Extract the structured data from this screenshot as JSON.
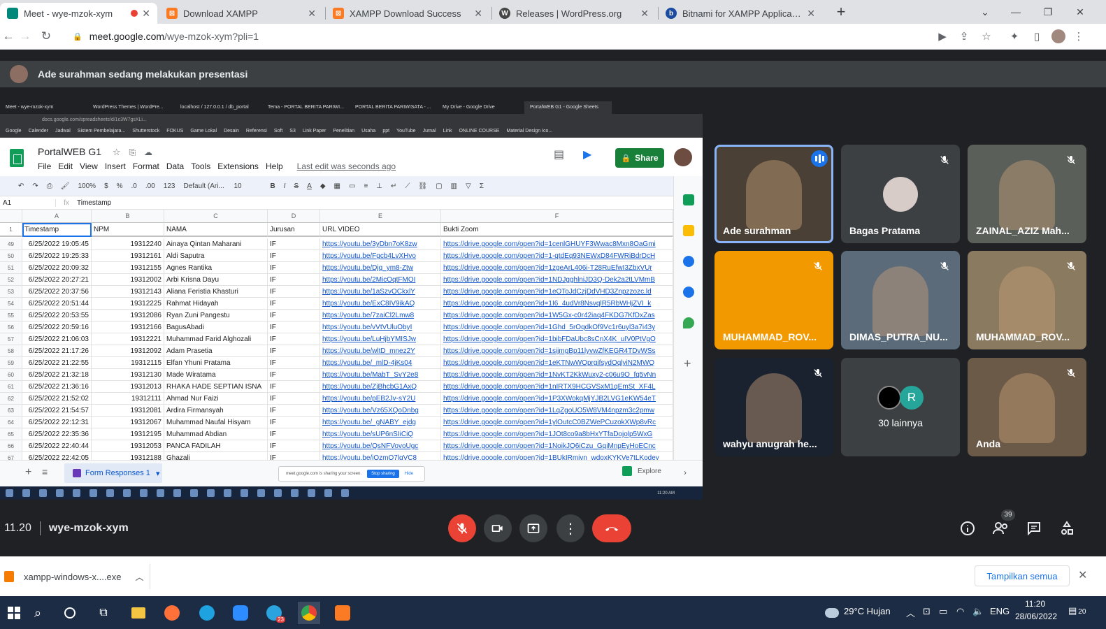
{
  "browser": {
    "tabs": [
      {
        "title": "Meet - wye-mzok-xym",
        "icon": "meet-icon",
        "color": "#00897b"
      },
      {
        "title": "Download XAMPP",
        "icon": "xampp-icon",
        "color": "#fb7a24"
      },
      {
        "title": "XAMPP Download Success",
        "icon": "xampp-icon",
        "color": "#fb7a24"
      },
      {
        "title": "Releases | WordPress.org",
        "icon": "wordpress-icon",
        "color": "#464646"
      },
      {
        "title": "Bitnami for XAMPP Application M",
        "icon": "bitnami-icon",
        "color": "#1c4ba0"
      }
    ],
    "url_host": "meet.google.com",
    "url_path": "/wye-mzok-xym?pli=1"
  },
  "presentation": {
    "banner": "Ade surahman sedang melakukan presentasi"
  },
  "shared_screen": {
    "inner_tabs": [
      "Meet - wye-mzok-xym",
      "WordPress Themes | WordPre...",
      "localhost / 127.0.0.1 / db_portal",
      "Tema - PORTAL BERITA PARIWI...",
      "PORTAL BERITA PARIWISATA - ...",
      "My Drive - Google Drive",
      "PortalWEB G1 - Google Sheets"
    ],
    "inner_url": "docs.google.com/spreadsheets/d/1c3W7gsXLi...",
    "bookmarks": [
      "Google",
      "Calender",
      "Jadwal",
      "Sistem Pembelajara...",
      "Shutterstock",
      "FOKUS",
      "Game Lokal",
      "Desain",
      "Referensi",
      "Soft",
      "S3",
      "Link Paper",
      "Penelitian",
      "Usaha",
      "ppt",
      "YouTube",
      "Jurnal",
      "Link",
      "ONLINE COURSE",
      "Material Design Ico..."
    ],
    "doc_title": "PortalWEB G1",
    "menu": [
      "File",
      "Edit",
      "View",
      "Insert",
      "Format",
      "Data",
      "Tools",
      "Extensions",
      "Help"
    ],
    "last_edit": "Last edit was seconds ago",
    "share_label": "Share",
    "toolbar": {
      "zoom": "100%",
      "currency": "$",
      "percent": "%",
      "dec_less": ".0",
      "dec_more": ".00",
      "num_format": "123",
      "font": "Default (Ari...",
      "font_size": "10"
    },
    "cell_ref": "A1",
    "formula": "Timestamp",
    "columns": [
      "A",
      "B",
      "C",
      "D",
      "E",
      "F"
    ],
    "headers": [
      "Timestamp",
      "NPM",
      "NAMA",
      "Jurusan",
      "URL VIDEO",
      "Bukti Zoom"
    ],
    "rows": [
      {
        "n": "49",
        "ts": "6/25/2022 19:05:45",
        "npm": "19312240",
        "nama": "Ainaya Qintan Maharani",
        "jur": "IF",
        "url": "https://youtu.be/3yDbn7oK8zw",
        "zoom": "https://drive.google.com/open?id=1cenlGHUYF3Wwac8Mxn8OaGmi"
      },
      {
        "n": "50",
        "ts": "6/25/2022 19:25:33",
        "npm": "19312161",
        "nama": "Aldi Saputra",
        "jur": "IF",
        "url": "https://youtu.be/Fgcb4LvXHvo",
        "zoom": "https://drive.google.com/open?id=1-qtdEq93NEWxD84FWRiBdrDcH"
      },
      {
        "n": "51",
        "ts": "6/25/2022 20:09:32",
        "npm": "19312155",
        "nama": "Agnes Rantika",
        "jur": "IF",
        "url": "https://youtu.be/Djq_ym8-Ztw",
        "zoom": "https://drive.google.com/open?id=1zgeArL406i-T28RuEfwI3ZbxVUr"
      },
      {
        "n": "52",
        "ts": "6/25/2022 20:27:21",
        "npm": "19312002",
        "nama": "Arbi Krisna Dayu",
        "jur": "IF",
        "url": "https://youtu.be/2MicOqtFMOI",
        "zoom": "https://drive.google.com/open?id=1NDJgghlniJD3Q-Dek2a2tLVMmB"
      },
      {
        "n": "53",
        "ts": "6/25/2022 20:37:56",
        "npm": "19312143",
        "nama": "Aliana Feristia Khasturi",
        "jur": "IF",
        "url": "https://youtu.be/1aSzvOCkxlY",
        "zoom": "https://drive.google.com/open?id=1eOToJdCzjDdVHD3Znpzzozc.ld"
      },
      {
        "n": "54",
        "ts": "6/25/2022 20:51:44",
        "npm": "19312225",
        "nama": "Rahmat Hidayah",
        "jur": "IF",
        "url": "https://youtu.be/ExC8IV9ikAQ",
        "zoom": "https://drive.google.com/open?id=1I6_4udVr8NsvqlR5RbWHjZVI_k"
      },
      {
        "n": "55",
        "ts": "6/25/2022 20:53:55",
        "npm": "19312086",
        "nama": "Ryan Zuni Pangestu",
        "jur": "IF",
        "url": "https://youtu.be/7zaiCl2Lmw8",
        "zoom": "https://drive.google.com/open?id=1W5Gx-c0r42iaq4FKDG7KfDxZas"
      },
      {
        "n": "56",
        "ts": "6/25/2022 20:59:16",
        "npm": "19312166",
        "nama": "BagusAbadi",
        "jur": "IF",
        "url": "https://youtu.be/vVtVUluObyI",
        "zoom": "https://drive.google.com/open?id=1Ghd_5rOqdkOf9Vc1r6uyl3a7i43y"
      },
      {
        "n": "57",
        "ts": "6/25/2022 21:06:03",
        "npm": "19312221",
        "nama": "Muhammad Farid Alghozali",
        "jur": "IF",
        "url": "https://youtu.be/LuHjbYMISJw",
        "zoom": "https://drive.google.com/open?id=1bibFDaUbc8sCnX4K_uIV0PtVgO"
      },
      {
        "n": "58",
        "ts": "6/25/2022 21:17:26",
        "npm": "19312092",
        "nama": "Adam Prasetia",
        "jur": "IF",
        "url": "https://youtu.be/wltD_mnez2Y",
        "zoom": "https://drive.google.com/open?id=1sijmgBp11lyvwZfKEGR4TDvWSs"
      },
      {
        "n": "59",
        "ts": "6/25/2022 21:22:55",
        "npm": "19312115",
        "nama": "Elfan Yhuni Pratama",
        "jur": "IF",
        "url": "https://youtu.be/_mlD-4jKs04",
        "zoom": "https://drive.google.com/open?id=1eKTNwWOprgifsydOqlyiN2MWQ"
      },
      {
        "n": "60",
        "ts": "6/25/2022 21:32:18",
        "npm": "19312130",
        "nama": "Made Wiratama",
        "jur": "IF",
        "url": "https://youtu.be/MabT_SvY2e8",
        "zoom": "https://drive.google.com/open?id=1NvKT2KkWuxy2-c06u9O_fq5vNn"
      },
      {
        "n": "61",
        "ts": "6/25/2022 21:36:16",
        "npm": "19312013",
        "nama": "RHAKA HADE SEPTIAN ISNA",
        "jur": "IF",
        "url": "https://youtu.be/ZjBhcbG1AxQ",
        "zoom": "https://drive.google.com/open?id=1nIRTX9HCGVSxM1qEmSt_XF4L"
      },
      {
        "n": "62",
        "ts": "6/25/2022 21:52:02",
        "npm": "19312111",
        "nama": "Ahmad Nur Faizi",
        "jur": "IF",
        "url": "https://youtu.be/pEB2Jv-sY2U",
        "zoom": "https://drive.google.com/open?id=1P3XWokqMjYJB2LVG1eKW54eT"
      },
      {
        "n": "63",
        "ts": "6/25/2022 21:54:57",
        "npm": "19312081",
        "nama": "Ardira Firmansyah",
        "jur": "IF",
        "url": "https://youtu.be/Vz65XQoDnbg",
        "zoom": "https://drive.google.com/open?id=1LqZgoUO5W8VM4npzm3c2pmw"
      },
      {
        "n": "64",
        "ts": "6/25/2022 22:12:31",
        "npm": "19312067",
        "nama": "Muhammad Naufal Hisyam",
        "jur": "IF",
        "url": "https://youtu.be/_gNABY_ejdg",
        "zoom": "https://drive.google.com/open?id=1ylOutcC0BZWePCuzokXWp8vRc"
      },
      {
        "n": "65",
        "ts": "6/25/2022 22:35:36",
        "npm": "19312195",
        "nama": "Muhammad Abdian",
        "jur": "IF",
        "url": "https://youtu.be/sUP6nSIiCiQ",
        "zoom": "https://drive.google.com/open?id=1JOt8co9a8bHxYTfaDojolp5WxG"
      },
      {
        "n": "66",
        "ts": "6/25/2022 22:40:44",
        "npm": "19312053",
        "nama": "PANCA FADILAH",
        "jur": "IF",
        "url": "https://youtu.be/QsNFVovoUgc",
        "zoom": "https://drive.google.com/open?id=1NoikJQ6iCzu_GqiMnpEyHoECnc"
      },
      {
        "n": "67",
        "ts": "6/25/2022 22:42:05",
        "npm": "19312188",
        "nama": "Ghazali",
        "jur": "IF",
        "url": "https://youtu.be/iOzmQ7lqVC8",
        "zoom": "https://drive.google.com/open?id=1BUkIRmivn_wdoxKYKVe7tLKodey"
      }
    ],
    "sheet_tab": "Form Responses 1",
    "stop_sharing_msg": "meet.google.com is sharing your screen.",
    "stop_sharing_btn": "Stop sharing",
    "hide_btn": "Hide",
    "explore": "Explore",
    "inner_clock": "11:20 AM"
  },
  "participants": [
    {
      "name": "Ade surahman",
      "bg": "#4a4035",
      "speaking": true
    },
    {
      "name": "Bagas Pratama",
      "bg": "#3c4043"
    },
    {
      "name": "ZAINAL_AZIZ Mah...",
      "bg": "#5a5f5a"
    },
    {
      "name": "MUHAMMAD_ROV...",
      "bg": "#f29900"
    },
    {
      "name": "DIMAS_PUTRA_NU...",
      "bg": "#5c6b7a"
    },
    {
      "name": "MUHAMMAD_ROV...",
      "bg": "#8a7a60"
    },
    {
      "name": "wahyu anugrah he...",
      "bg": "#1a2230"
    },
    {
      "name": "30 lainnya",
      "bg": "#3c4043",
      "initial": "R"
    },
    {
      "name": "Anda",
      "bg": "#6b5a48"
    }
  ],
  "meeting": {
    "time": "11.20",
    "code": "wye-mzok-xym",
    "people_count": "39"
  },
  "download": {
    "file": "xampp-windows-x....exe",
    "show_all": "Tampilkan semua"
  },
  "taskbar": {
    "weather": "29°C  Hujan",
    "lang": "ENG",
    "time": "11:20",
    "date": "28/06/2022",
    "notif": "20",
    "telegram_badge": "23"
  }
}
